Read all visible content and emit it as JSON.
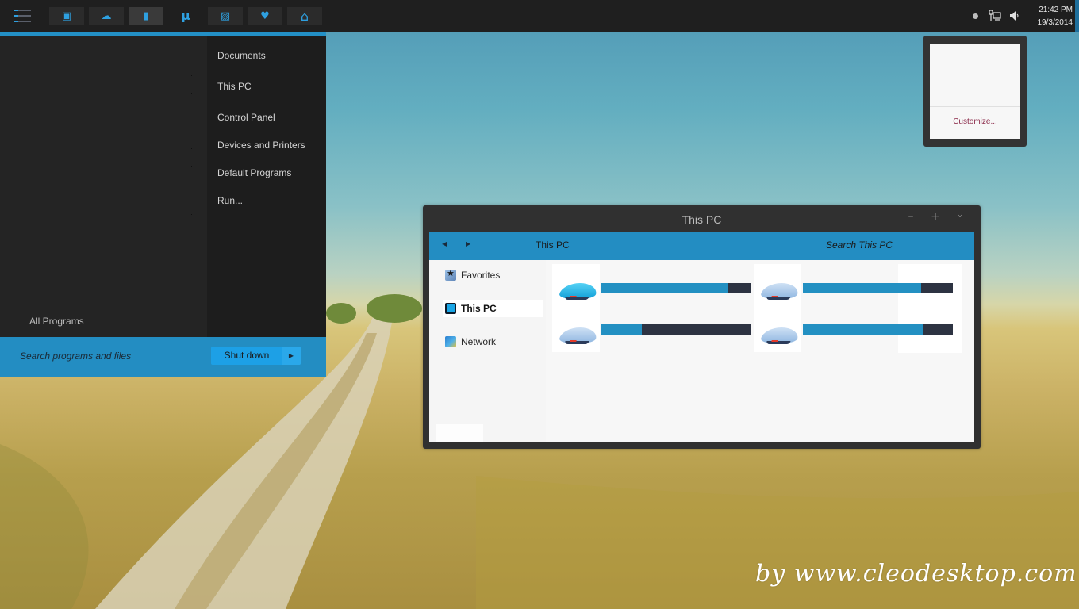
{
  "taskbar": {
    "menu_icon": "hamburger-menu-icon",
    "pinned": [
      {
        "name": "media-player",
        "icon": "media-icon",
        "glyph": "▣",
        "active": false
      },
      {
        "name": "onedrive",
        "icon": "cloud-icon",
        "glyph": "☁",
        "active": false
      },
      {
        "name": "documents",
        "icon": "document-icon",
        "glyph": "▮",
        "active": true
      },
      {
        "name": "utorrent",
        "icon": "utorrent-icon",
        "glyph": "μ",
        "active": false
      },
      {
        "name": "pictures",
        "icon": "picture-icon",
        "glyph": "▨",
        "active": false
      },
      {
        "name": "favorites",
        "icon": "heart-icon",
        "glyph": "♥",
        "active": false
      },
      {
        "name": "home",
        "icon": "home-icon",
        "glyph": "⌂",
        "active": false
      }
    ],
    "tray": {
      "icons": [
        "notification-dot-icon",
        "network-icon",
        "volume-icon"
      ],
      "time": "21:42 PM",
      "date": "19/3/2014"
    }
  },
  "start_menu": {
    "items": [
      "Documents",
      "This PC",
      "Control Panel",
      "Devices and Printers",
      "Default Programs",
      "Run..."
    ],
    "all_programs": "All Programs",
    "search_placeholder": "Search programs and files",
    "shutdown_label": "Shut down",
    "shutdown_arrow": "▶"
  },
  "tray_popup": {
    "link": "Customize..."
  },
  "explorer": {
    "title": "This PC",
    "controls": {
      "minimize": "–",
      "maximize": "+",
      "close": "⌄"
    },
    "nav": {
      "back": "◀",
      "forward": "▶"
    },
    "location": "This PC",
    "search_placeholder": "Search This PC",
    "nav_pane": [
      {
        "label": "Favorites",
        "icon": "favorites-star-icon",
        "selected": false
      },
      {
        "label": "This PC",
        "icon": "computer-icon",
        "selected": true
      },
      {
        "label": "Network",
        "icon": "network-globe-icon",
        "selected": false
      }
    ],
    "drives": [
      {
        "name": "drive-1",
        "icon": "hard-drive-icon",
        "used_fraction": 0.84,
        "system": true
      },
      {
        "name": "drive-2",
        "icon": "hard-drive-icon",
        "used_fraction": 0.79,
        "system": false
      },
      {
        "name": "drive-3",
        "icon": "hard-drive-icon",
        "used_fraction": 0.27,
        "system": false
      },
      {
        "name": "drive-4",
        "icon": "hard-drive-icon",
        "used_fraction": 0.8,
        "system": false
      }
    ]
  },
  "watermark": "by www.cleodesktop.com",
  "colors": {
    "accent": "#2390c6",
    "taskbar": "#1f1f1f",
    "icon_blue": "#2ea0e0",
    "drive_used": "#2390c2",
    "drive_free": "#2d3342",
    "customize_link": "#8a2848"
  }
}
